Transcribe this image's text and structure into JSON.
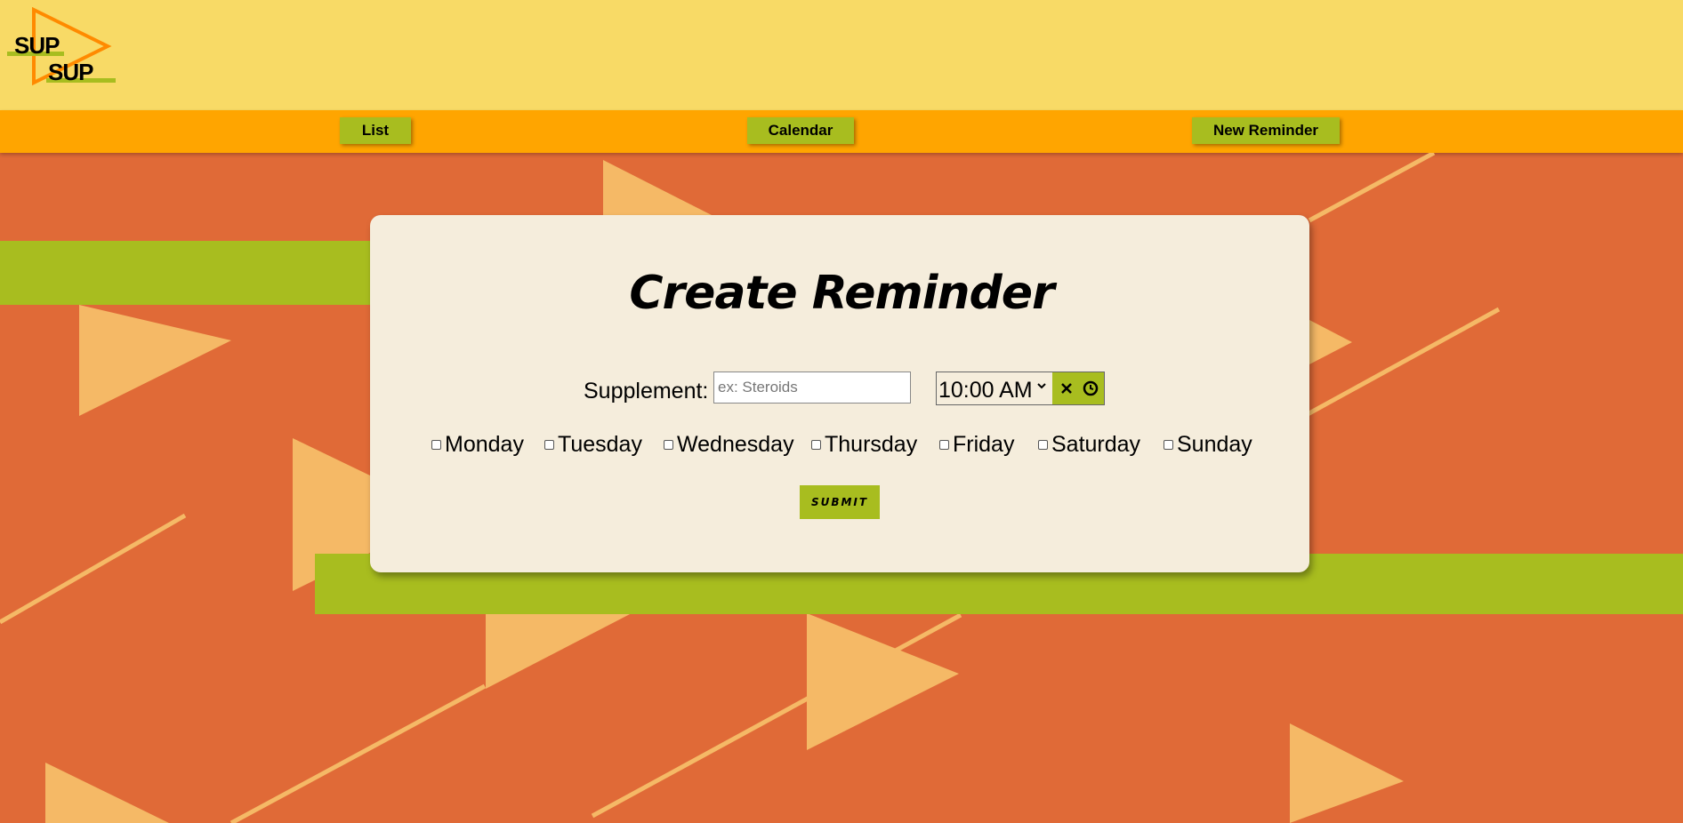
{
  "logo": {
    "line1": "SUP",
    "line2": "SUP"
  },
  "nav": {
    "list": "List",
    "calendar": "Calendar",
    "new_reminder": "New Reminder"
  },
  "form": {
    "title": "Create Reminder",
    "supplement_label": "Supplement:",
    "supplement_placeholder": "ex: Steroids",
    "supplement_value": "",
    "time_value": "10:00  AM",
    "days": [
      "Monday",
      "Tuesday",
      "Wednesday",
      "Thursday",
      "Friday",
      "Saturday",
      "Sunday"
    ],
    "submit": "SUBMIT"
  },
  "icons": {
    "time_dropdown": "chevron-down-icon",
    "time_clear": "close-icon",
    "time_clock": "clock-icon",
    "logo": "play-triangle-icon"
  },
  "colors": {
    "header_bg": "#f8da66",
    "nav_bg": "#ffa500",
    "page_bg": "#e06a37",
    "accent_green": "#a8bd1f",
    "triangle_light": "#f5b966",
    "card_bg": "#f5eddc"
  }
}
